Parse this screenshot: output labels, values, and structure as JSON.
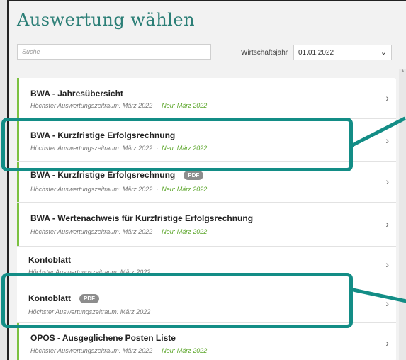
{
  "title": "Auswertung wählen",
  "search": {
    "placeholder": "Suche"
  },
  "fiscal_year": {
    "label": "Wirtschaftsjahr",
    "value": "01.01.2022"
  },
  "items": [
    {
      "name": "BWA - Jahresübersicht",
      "sub": "Höchster Auswertungszeitraum: März 2022",
      "sep": "·",
      "neu": "Neu: März 2022"
    },
    {
      "name": "BWA - Kurzfristige Erfolgsrechnung",
      "sub": "Höchster Auswertungszeitraum: März 2022",
      "sep": "·",
      "neu": "Neu: März 2022"
    },
    {
      "name": "BWA - Kurzfristige Erfolgsrechnung",
      "badge": "PDF",
      "sub": "Höchster Auswertungszeitraum: März 2022",
      "sep": "·",
      "neu": "Neu: März 2022"
    },
    {
      "name": "BWA - Wertenachweis für Kurzfristige Erfolgsrechnung",
      "sub": "Höchster Auswertungszeitraum: März 2022",
      "sep": "·",
      "neu": "Neu: März 2022"
    },
    {
      "name": "Kontoblatt",
      "sub": "Höchster Auswertungszeitraum: März 2022"
    },
    {
      "name": "Kontoblatt",
      "badge": "PDF",
      "sub": "Höchster Auswertungszeitraum: März 2022"
    },
    {
      "name": "OPOS - Ausgeglichene Posten Liste",
      "sub": "Höchster Auswertungszeitraum: März 2022",
      "sep": "·",
      "neu": "Neu: März 2022"
    }
  ],
  "icons": {
    "chevron": "chevron-right-icon",
    "select": "chevron-down-icon"
  },
  "colors": {
    "accent": "#2c7f77",
    "highlight": "#138d86",
    "new_green": "#5aa528",
    "bar_green": "#7cc142"
  }
}
